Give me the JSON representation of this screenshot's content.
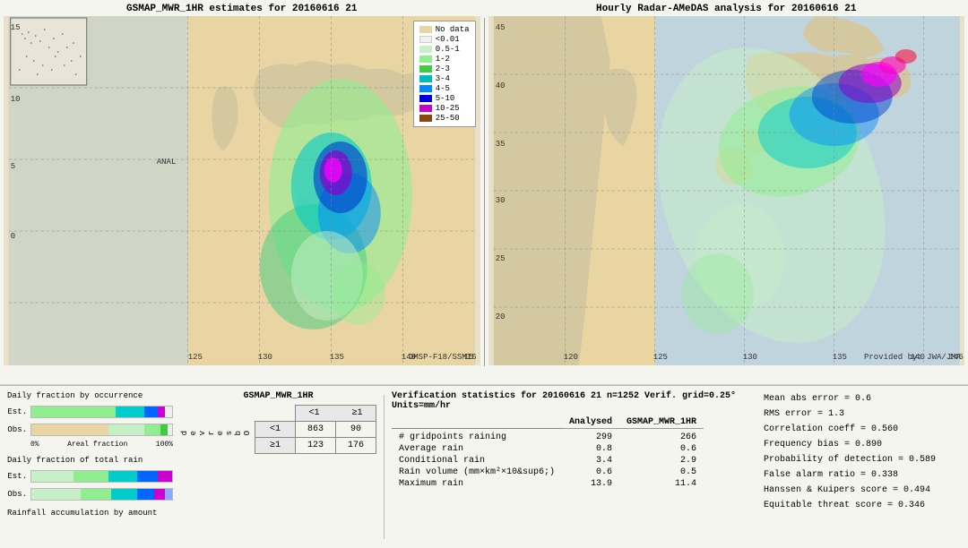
{
  "left_map": {
    "title": "GSMAP_MWR_1HR estimates for 20160616 21",
    "label_anal": "ANAL",
    "label_dmsp": "DMSP-F18/SSMIS",
    "lat_labels": [
      "15",
      "10",
      "5",
      "0"
    ],
    "lon_labels": [
      "125",
      "130",
      "135",
      "140",
      "145",
      "15"
    ]
  },
  "right_map": {
    "title": "Hourly Radar-AMeDAS analysis for 20160616 21",
    "label_provided": "Provided by: JWA/JMA",
    "lat_labels": [
      "45",
      "40",
      "35",
      "30",
      "25",
      "20"
    ],
    "lon_labels": [
      "120",
      "125",
      "130",
      "135",
      "140",
      "145",
      "15"
    ]
  },
  "legend": {
    "title": "",
    "items": [
      {
        "label": "No data",
        "color": "#e8d5a3"
      },
      {
        "label": "<0.01",
        "color": "#f5f5f5"
      },
      {
        "label": "0.5-1",
        "color": "#c8f0c8"
      },
      {
        "label": "1-2",
        "color": "#90e090"
      },
      {
        "label": "2-3",
        "color": "#40cc40"
      },
      {
        "label": "3-4",
        "color": "#00bbbb"
      },
      {
        "label": "4-5",
        "color": "#0088ff"
      },
      {
        "label": "5-10",
        "color": "#0000dd"
      },
      {
        "label": "10-25",
        "color": "#cc00cc"
      },
      {
        "label": "25-50",
        "color": "#8b4513"
      }
    ]
  },
  "charts": {
    "occurrence_title": "Daily fraction by occurrence",
    "rain_title": "Daily fraction of total rain",
    "rainfall_title": "Rainfall accumulation by amount",
    "est_label": "Est.",
    "obs_label": "Obs.",
    "axis_left": "0%",
    "axis_right": "100%",
    "axis_mid": "Areal fraction"
  },
  "contingency": {
    "title": "GSMAP_MWR_1HR",
    "col_less1": "<1",
    "col_more1": "≥1",
    "row_less1": "<1",
    "row_more1": "≥1",
    "observed_label": "O\nb\ns\ne\nr\nv\ne\nd",
    "val_11": "863",
    "val_12": "90",
    "val_21": "123",
    "val_22": "176"
  },
  "verification": {
    "title": "Verification statistics for 20160616 21  n=1252  Verif. grid=0.25°  Units=mm/hr",
    "col_analysed": "Analysed",
    "col_gsmap": "GSMAP_MWR_1HR",
    "rows": [
      {
        "name": "# gridpoints raining",
        "analysed": "299",
        "gsmap": "266"
      },
      {
        "name": "Average rain",
        "analysed": "0.8",
        "gsmap": "0.6"
      },
      {
        "name": "Conditional rain",
        "analysed": "3.4",
        "gsmap": "2.9"
      },
      {
        "name": "Rain volume (mm×km²×10⁶)",
        "analysed": "0.6",
        "gsmap": "0.5"
      },
      {
        "name": "Maximum rain",
        "analysed": "13.9",
        "gsmap": "11.4"
      }
    ]
  },
  "right_stats": {
    "mean_abs_error": "Mean abs error = 0.6",
    "rms_error": "RMS error = 1.3",
    "correlation": "Correlation coeff = 0.560",
    "freq_bias": "Frequency bias = 0.890",
    "prob_detection": "Probability of detection = 0.589",
    "false_alarm": "False alarm ratio = 0.338",
    "hanssen": "Hanssen & Kuipers score = 0.494",
    "equitable": "Equitable threat score = 0.346"
  }
}
